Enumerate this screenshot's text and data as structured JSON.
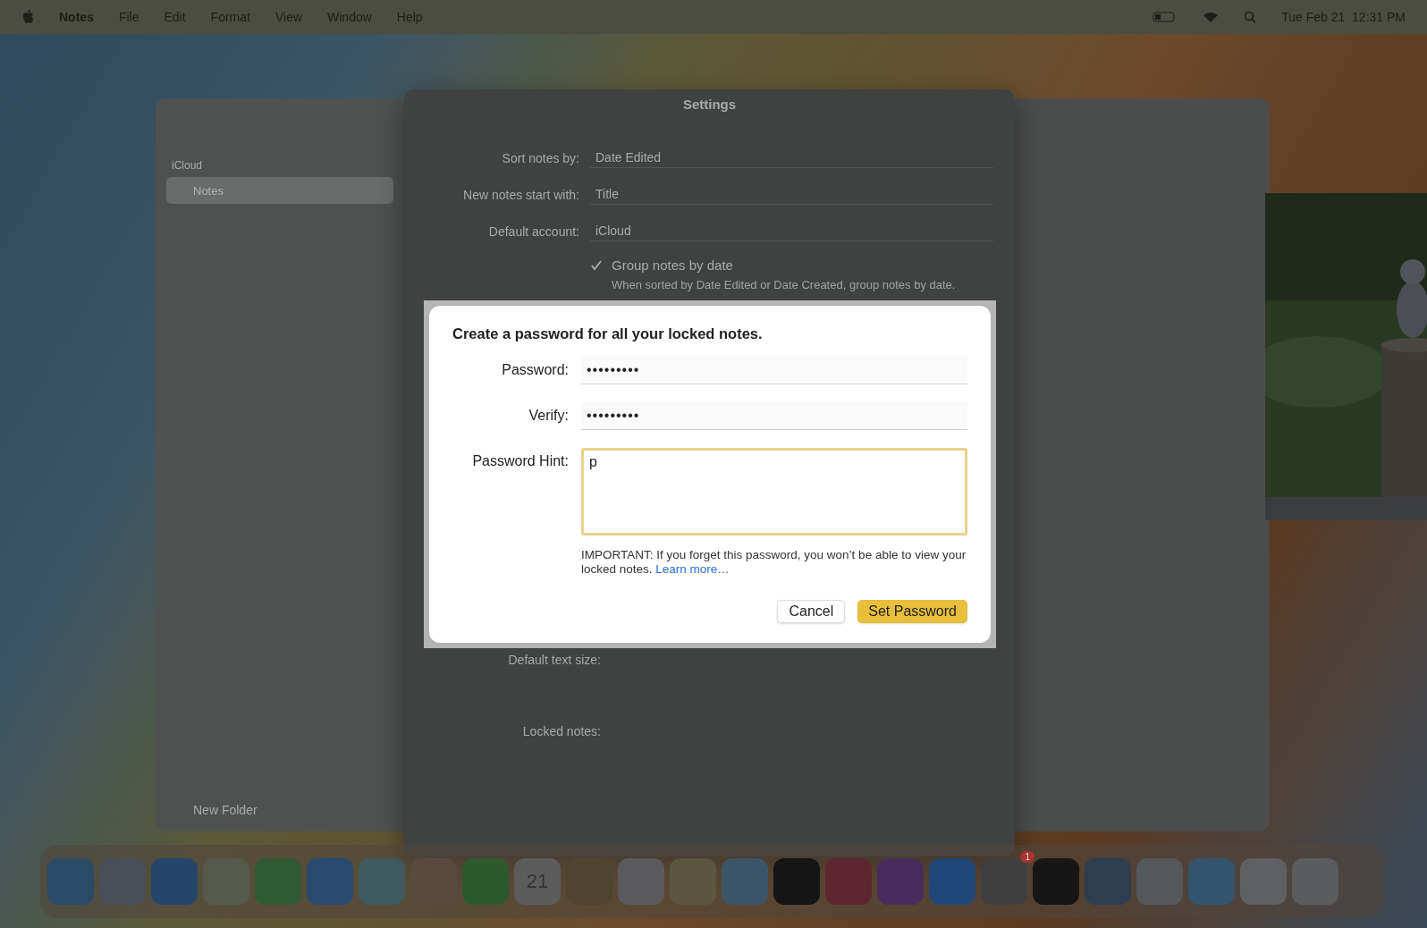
{
  "menu_bar": {
    "app_name": "Notes",
    "menus": [
      "File",
      "Edit",
      "Format",
      "View",
      "Window",
      "Help"
    ],
    "clock": "Tue Feb 21  12:31 PM"
  },
  "notes_window": {
    "sidebar": {
      "section": "iCloud",
      "folders": [
        {
          "label": "Notes",
          "selected": true
        }
      ],
      "new_folder": "New Folder"
    }
  },
  "settings": {
    "title": "Settings",
    "rows": [
      {
        "kind": "select",
        "label": "Sort notes by:",
        "value": "Date Edited"
      },
      {
        "kind": "select",
        "label": "New notes start with:",
        "value": "Title"
      },
      {
        "kind": "select",
        "label": "Default account:",
        "value": "iCloud"
      },
      {
        "kind": "check",
        "label": "Group notes by date",
        "checked": true,
        "note": "When sorted by Date Edited or Date Created, group notes by date."
      }
    ],
    "lower_rows": [
      {
        "label": "Default text size:"
      },
      {
        "label": "Locked notes:"
      }
    ]
  },
  "dialog": {
    "title": "Create a password for all your locked notes.",
    "fields": [
      {
        "label": "Password:",
        "value": "•••••••••",
        "focused": false
      },
      {
        "label": "Verify:",
        "value": "•••••••••",
        "focused": false
      }
    ],
    "hint": {
      "label": "Password Hint:",
      "value": "p",
      "focused": true
    },
    "notice": "IMPORTANT: If you forget this password, you won’t be able to view your locked notes.",
    "link": "Learn more…",
    "buttons": [
      {
        "label": "Cancel",
        "default": false
      },
      {
        "label": "Set Password",
        "default": true
      }
    ]
  },
  "dock": {
    "calendar_day": "21",
    "badge": "1",
    "apps": [
      {
        "color": "#2b4a66"
      },
      {
        "color": "#4a4f57"
      },
      {
        "color": "#24466a"
      },
      {
        "color": "#555a4a"
      },
      {
        "color": "#2f5a32"
      },
      {
        "color": "#284a6e"
      },
      {
        "color": "#3d5a5e"
      },
      {
        "color": "#5a4a3e"
      },
      {
        "color": "#2c5a2e"
      },
      {
        "color": "#5c5c5c"
      },
      {
        "color": "#4e4430"
      },
      {
        "color": "#5a5a5c"
      },
      {
        "color": "#5c5640"
      },
      {
        "color": "#3b5568"
      },
      {
        "color": "#151515"
      },
      {
        "color": "#5e2630"
      },
      {
        "color": "#4a2c5c"
      },
      {
        "color": "#1f4878"
      },
      {
        "color": "#3f3f3f"
      },
      {
        "color": "#161616"
      },
      {
        "color": "#2c3e50"
      },
      {
        "color": "#55585a"
      },
      {
        "color": "#34546e"
      },
      {
        "color": "#5e6062"
      },
      {
        "color": "#5a5c5e"
      }
    ]
  }
}
